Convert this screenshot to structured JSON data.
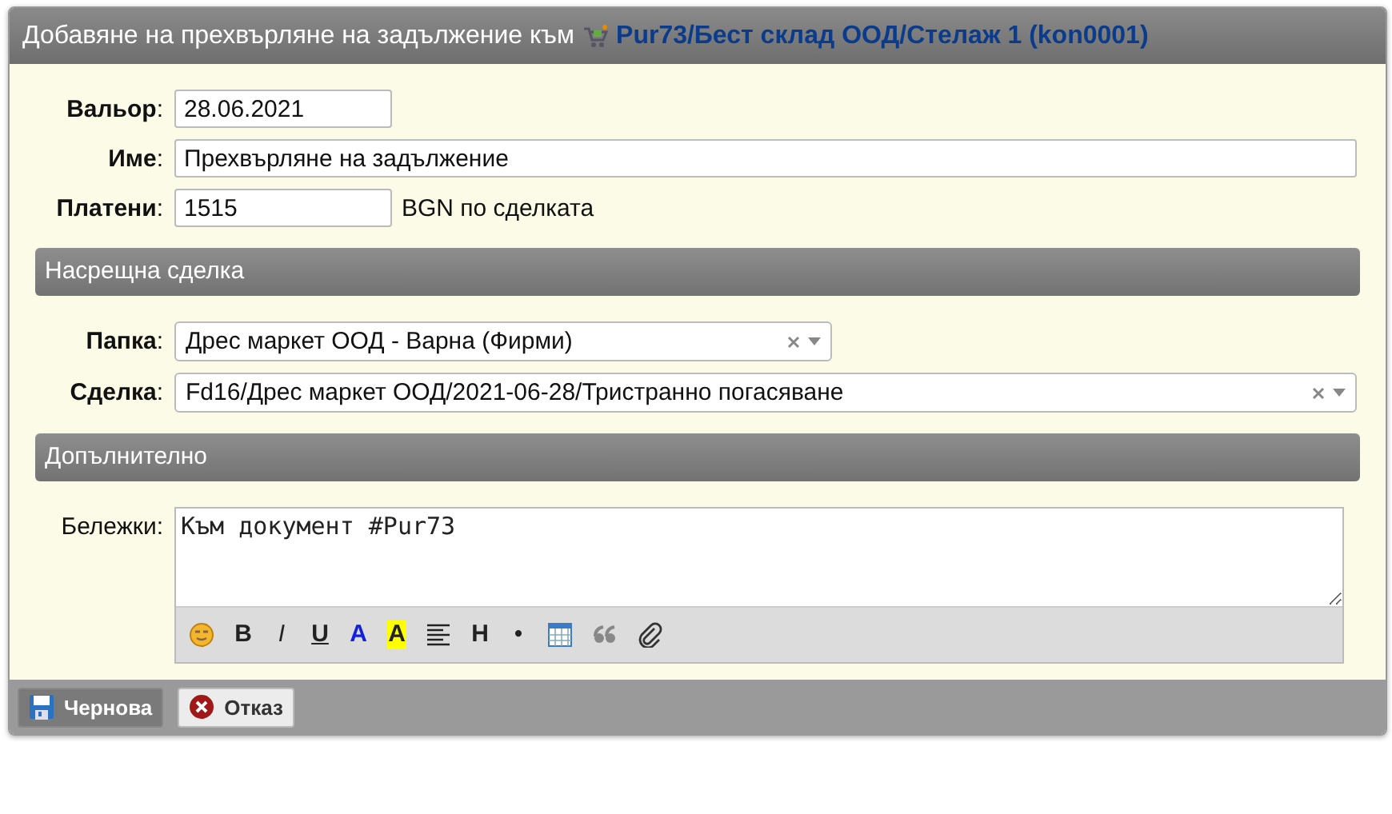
{
  "window": {
    "title": "Добавяне на прехвърляне на задължение към",
    "title_link": "Pur73/Бест склад ООД/Стелаж 1 (kon0001)"
  },
  "fields": [
    {
      "label": "**Вальор**:",
      "value": "28.06.2021",
      "kind": "short"
    },
    {
      "label": "**Име**:",
      "value": "Прехвърляне на задължение",
      "kind": "wide"
    },
    {
      "label": "**Платени**:",
      "value": "1515",
      "kind": "short",
      "suffix": "BGN по сделката"
    }
  ],
  "sections": [
    {
      "title": "Насрещна сделка",
      "selects": [
        {
          "label": "**Папка**:",
          "value": "Дрес маркет ООД - Варна (Фирми)",
          "kind": "medium"
        },
        {
          "label": "**Сделка**:",
          "value": "Fd16/Дрес маркет ООД/2021-06-28/Тристранно погасяване",
          "kind": "wide"
        }
      ]
    },
    {
      "title": "Допълнително",
      "notes": {
        "label": "Бележки:",
        "value": "Към документ #Pur73"
      }
    }
  ],
  "toolbar": [
    {
      "kind": "smiley"
    },
    {
      "kind": "bold",
      "label": "B"
    },
    {
      "kind": "italic",
      "label": "I"
    },
    {
      "kind": "underline",
      "label": "U"
    },
    {
      "kind": "color",
      "label": "A"
    },
    {
      "kind": "highlight",
      "label": "A"
    },
    {
      "kind": "align"
    },
    {
      "kind": "heading",
      "label": "H"
    },
    {
      "kind": "bullet",
      "label": "•"
    },
    {
      "kind": "table"
    },
    {
      "kind": "quote"
    },
    {
      "kind": "clip"
    }
  ],
  "buttons": [
    {
      "label": "Чернова",
      "kind": "save"
    },
    {
      "label": "Отказ",
      "kind": "cancel"
    }
  ]
}
